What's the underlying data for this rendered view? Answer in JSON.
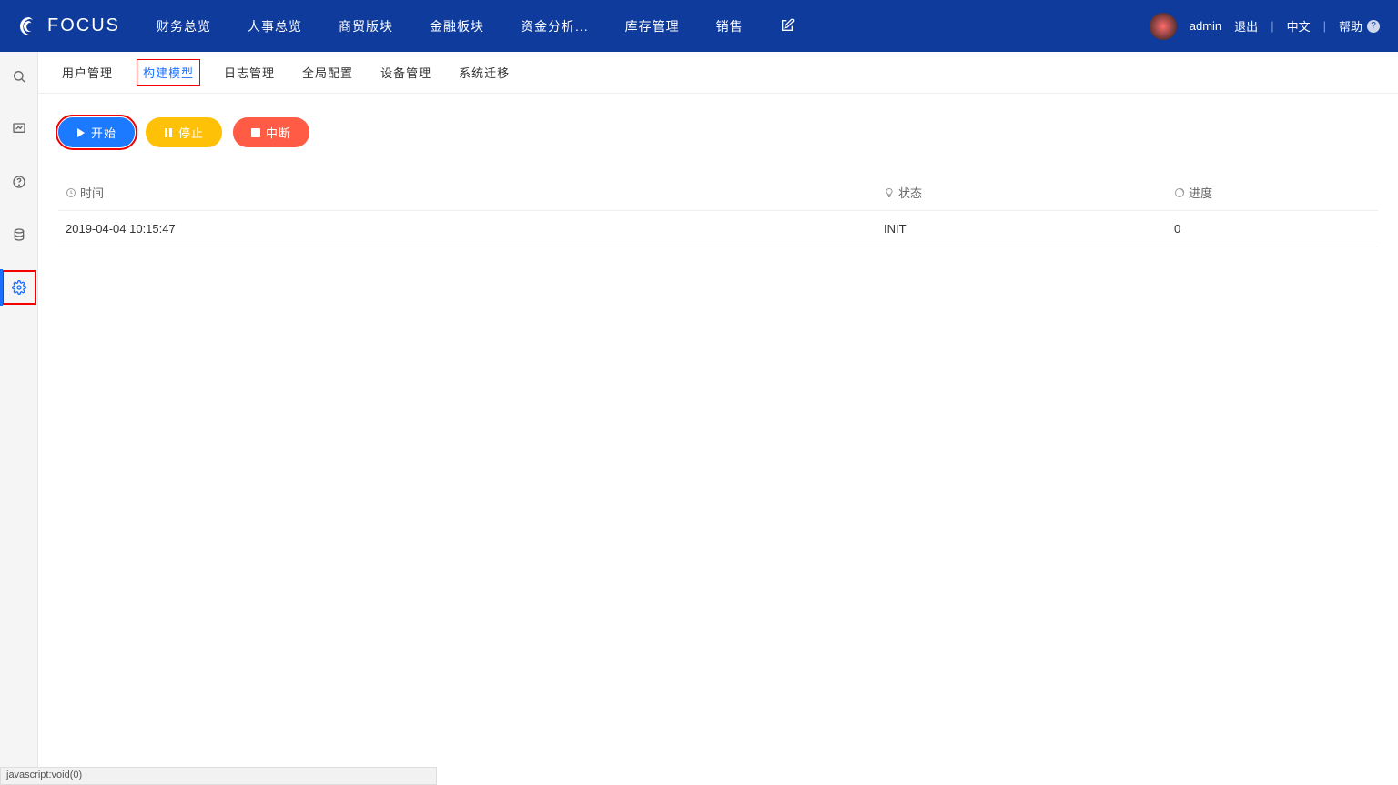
{
  "brand": "FOCUS",
  "topnav": {
    "items": [
      {
        "label": "财务总览"
      },
      {
        "label": "人事总览"
      },
      {
        "label": "商贸版块"
      },
      {
        "label": "金融板块"
      },
      {
        "label": "资金分析..."
      },
      {
        "label": "库存管理"
      },
      {
        "label": "销售"
      }
    ]
  },
  "user": {
    "name": "admin",
    "logout": "退出",
    "lang": "中文",
    "help": "帮助",
    "help_badge": "?"
  },
  "subnav": {
    "items": [
      {
        "label": "用户管理"
      },
      {
        "label": "构建模型"
      },
      {
        "label": "日志管理"
      },
      {
        "label": "全局配置"
      },
      {
        "label": "设备管理"
      },
      {
        "label": "系统迁移"
      }
    ]
  },
  "actions": {
    "start": "开始",
    "stop": "停止",
    "abort": "中断"
  },
  "table": {
    "headers": {
      "time": "时间",
      "status": "状态",
      "progress": "进度"
    },
    "rows": [
      {
        "time": "2019-04-04 10:15:47",
        "status": "INIT",
        "progress": "0"
      }
    ]
  },
  "statusbar": "javascript:void(0)"
}
